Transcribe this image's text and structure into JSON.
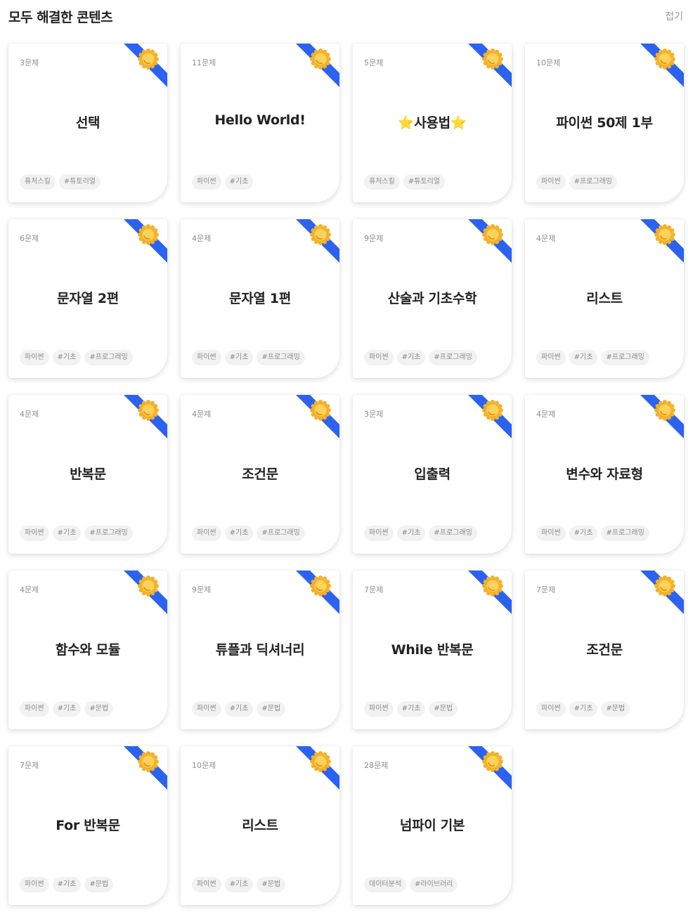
{
  "header": {
    "title": "모두 해결한 콘텐츠",
    "collapse_label": "접기"
  },
  "colors": {
    "ribbon": "#2b63f0",
    "medal": "#f5b12a",
    "medal_inner": "#ffd25a"
  },
  "icons": {
    "ribbon": "completion-ribbon-icon",
    "medal": "medal-icon"
  },
  "cards": [
    {
      "count": "3문제",
      "title": "선택",
      "tags": [
        "퓨처스킬",
        "#튜토리얼"
      ]
    },
    {
      "count": "11문제",
      "title": "Hello World!",
      "tags": [
        "파이썬",
        "#기초"
      ]
    },
    {
      "count": "5문제",
      "title": "⭐사용법⭐",
      "tags": [
        "퓨처스킬",
        "#튜토리얼"
      ]
    },
    {
      "count": "10문제",
      "title": "파이썬 50제 1부",
      "tags": [
        "파이썬",
        "#프로그래밍"
      ]
    },
    {
      "count": "6문제",
      "title": "문자열 2편",
      "tags": [
        "파이썬",
        "#기초",
        "#프로그래밍"
      ]
    },
    {
      "count": "4문제",
      "title": "문자열 1편",
      "tags": [
        "파이썬",
        "#기초",
        "#프로그래밍"
      ]
    },
    {
      "count": "9문제",
      "title": "산술과 기초수학",
      "tags": [
        "파이썬",
        "#기초",
        "#프로그래밍"
      ]
    },
    {
      "count": "4문제",
      "title": "리스트",
      "tags": [
        "파이썬",
        "#기초",
        "#프로그래밍"
      ]
    },
    {
      "count": "4문제",
      "title": "반복문",
      "tags": [
        "파이썬",
        "#기초",
        "#프로그래밍"
      ]
    },
    {
      "count": "4문제",
      "title": "조건문",
      "tags": [
        "파이썬",
        "#기초",
        "#프로그래밍"
      ]
    },
    {
      "count": "3문제",
      "title": "입출력",
      "tags": [
        "파이썬",
        "#기초",
        "#프로그래밍"
      ]
    },
    {
      "count": "4문제",
      "title": "변수와 자료형",
      "tags": [
        "파이썬",
        "#기초",
        "#프로그래밍"
      ]
    },
    {
      "count": "4문제",
      "title": "함수와 모듈",
      "tags": [
        "파이썬",
        "#기초",
        "#문법"
      ]
    },
    {
      "count": "9문제",
      "title": "튜플과 딕셔너리",
      "tags": [
        "파이썬",
        "#기초",
        "#문법"
      ]
    },
    {
      "count": "7문제",
      "title": "While 반복문",
      "tags": [
        "파이썬",
        "#기초",
        "#문법"
      ]
    },
    {
      "count": "7문제",
      "title": "조건문",
      "tags": [
        "파이썬",
        "#기초",
        "#문법"
      ]
    },
    {
      "count": "7문제",
      "title": "For 반복문",
      "tags": [
        "파이썬",
        "#기초",
        "#문법"
      ]
    },
    {
      "count": "10문제",
      "title": "리스트",
      "tags": [
        "파이썬",
        "#기초",
        "#문법"
      ]
    },
    {
      "count": "28문제",
      "title": "넘파이 기본",
      "tags": [
        "데이터분석",
        "#라이브러리"
      ]
    }
  ]
}
